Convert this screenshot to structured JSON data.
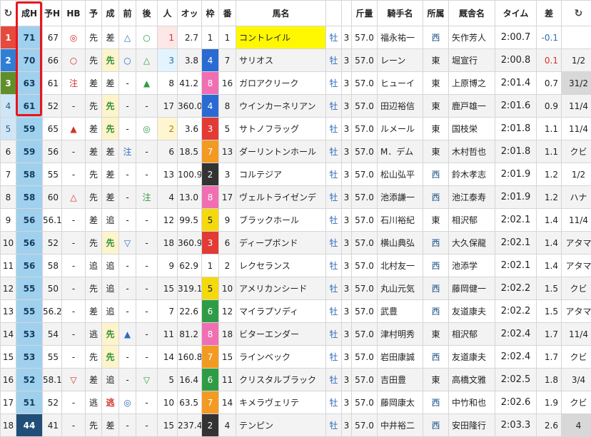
{
  "header": {
    "reload_left": "↻",
    "cols": [
      "成H",
      "予H",
      "HB",
      "予",
      "成",
      "前",
      "後",
      "人",
      "オッ",
      "枠",
      "番",
      "馬名",
      "",
      "",
      "斤量",
      "騎手名",
      "所属",
      "厩舎名",
      "タイム",
      "差"
    ],
    "reload_right": "↻"
  },
  "rows": [
    {
      "rank": "1",
      "h": "71",
      "yh": "67",
      "hb": "◎",
      "yo": "先",
      "sei": "差",
      "mae": "△",
      "ato": "○",
      "ninki": "1",
      "odds": "2.7",
      "waku": "1",
      "ban": "1",
      "name": "コントレイル",
      "sex": "牡",
      "age": "3",
      "kin": "57.0",
      "jockey": "福永祐一",
      "shozoku": "西",
      "trainer": "矢作芳人",
      "time": "2:00.7",
      "sa": "-0.1",
      "last": ""
    },
    {
      "rank": "2",
      "h": "70",
      "yh": "66",
      "hb": "○",
      "yo": "先",
      "sei": "先",
      "mae": "○",
      "ato": "△",
      "ninki": "3",
      "odds": "3.8",
      "waku": "4",
      "ban": "7",
      "name": "サリオス",
      "sex": "牡",
      "age": "3",
      "kin": "57.0",
      "jockey": "レーン",
      "shozoku": "東",
      "trainer": "堀宣行",
      "time": "2:00.8",
      "sa": "0.1",
      "last": "1/2"
    },
    {
      "rank": "3",
      "h": "63",
      "yh": "61",
      "hb": "注",
      "yo": "差",
      "sei": "差",
      "mae": "-",
      "ato": "▲",
      "ninki": "8",
      "odds": "41.2",
      "waku": "8",
      "ban": "16",
      "name": "ガロアクリーク",
      "sex": "牡",
      "age": "3",
      "kin": "57.0",
      "jockey": "ヒューイ",
      "shozoku": "東",
      "trainer": "上原博之",
      "time": "2:01.4",
      "sa": "0.7",
      "last": "31/2"
    },
    {
      "rank": "4",
      "h": "61",
      "yh": "52",
      "hb": "-",
      "yo": "先",
      "sei": "先",
      "mae": "-",
      "ato": "-",
      "ninki": "17",
      "odds": "360.0",
      "waku": "4",
      "ban": "8",
      "name": "ウインカーネリアン",
      "sex": "牡",
      "age": "3",
      "kin": "57.0",
      "jockey": "田辺裕信",
      "shozoku": "東",
      "trainer": "鹿戸雄一",
      "time": "2:01.6",
      "sa": "0.9",
      "last": "11/4"
    },
    {
      "rank": "5",
      "h": "59",
      "yh": "65",
      "hb": "▲",
      "yo": "差",
      "sei": "先",
      "mae": "-",
      "ato": "◎",
      "ninki": "2",
      "odds": "3.6",
      "waku": "3",
      "ban": "5",
      "name": "サトノフラッグ",
      "sex": "牡",
      "age": "3",
      "kin": "57.0",
      "jockey": "ルメール",
      "shozoku": "東",
      "trainer": "国枝栄",
      "time": "2:01.8",
      "sa": "1.1",
      "last": "11/4"
    },
    {
      "rank": "6",
      "h": "59",
      "yh": "56",
      "hb": "-",
      "yo": "差",
      "sei": "差",
      "mae": "注",
      "ato": "-",
      "ninki": "6",
      "odds": "18.5",
      "waku": "7",
      "ban": "13",
      "name": "ダーリントンホール",
      "sex": "牡",
      "age": "3",
      "kin": "57.0",
      "jockey": "M．デム",
      "shozoku": "東",
      "trainer": "木村哲也",
      "time": "2:01.8",
      "sa": "1.1",
      "last": "クビ"
    },
    {
      "rank": "7",
      "h": "58",
      "yh": "55",
      "hb": "-",
      "yo": "先",
      "sei": "差",
      "mae": "-",
      "ato": "-",
      "ninki": "13",
      "odds": "100.9",
      "waku": "2",
      "ban": "3",
      "name": "コルテジア",
      "sex": "牡",
      "age": "3",
      "kin": "57.0",
      "jockey": "松山弘平",
      "shozoku": "西",
      "trainer": "鈴木孝志",
      "time": "2:01.9",
      "sa": "1.2",
      "last": "1/2"
    },
    {
      "rank": "8",
      "h": "58",
      "yh": "60",
      "hb": "△",
      "yo": "先",
      "sei": "差",
      "mae": "-",
      "ato": "注",
      "ninki": "4",
      "odds": "13.0",
      "waku": "8",
      "ban": "17",
      "name": "ヴェルトライゼンデ",
      "sex": "牡",
      "age": "3",
      "kin": "57.0",
      "jockey": "池添謙一",
      "shozoku": "西",
      "trainer": "池江泰寿",
      "time": "2:01.9",
      "sa": "1.2",
      "last": "ハナ"
    },
    {
      "rank": "9",
      "h": "56",
      "yh": "56.1",
      "hb": "-",
      "yo": "差",
      "sei": "追",
      "mae": "-",
      "ato": "-",
      "ninki": "12",
      "odds": "99.5",
      "waku": "5",
      "ban": "9",
      "name": "ブラックホール",
      "sex": "牡",
      "age": "3",
      "kin": "57.0",
      "jockey": "石川裕紀",
      "shozoku": "東",
      "trainer": "相沢郁",
      "time": "2:02.1",
      "sa": "1.4",
      "last": "11/4"
    },
    {
      "rank": "10",
      "h": "56",
      "yh": "52",
      "hb": "-",
      "yo": "先",
      "sei": "先",
      "mae": "▽",
      "ato": "-",
      "ninki": "18",
      "odds": "360.9",
      "waku": "3",
      "ban": "6",
      "name": "ディープボンド",
      "sex": "牡",
      "age": "3",
      "kin": "57.0",
      "jockey": "横山典弘",
      "shozoku": "西",
      "trainer": "大久保龍",
      "time": "2:02.1",
      "sa": "1.4",
      "last": "アタマ"
    },
    {
      "rank": "11",
      "h": "56",
      "yh": "58",
      "hb": "-",
      "yo": "追",
      "sei": "追",
      "mae": "-",
      "ato": "-",
      "ninki": "9",
      "odds": "62.9",
      "waku": "1",
      "ban": "2",
      "name": "レクセランス",
      "sex": "牡",
      "age": "3",
      "kin": "57.0",
      "jockey": "北村友一",
      "shozoku": "西",
      "trainer": "池添学",
      "time": "2:02.1",
      "sa": "1.4",
      "last": "アタマ"
    },
    {
      "rank": "12",
      "h": "55",
      "yh": "50",
      "hb": "-",
      "yo": "先",
      "sei": "追",
      "mae": "-",
      "ato": "-",
      "ninki": "15",
      "odds": "319.1",
      "waku": "5",
      "ban": "10",
      "name": "アメリカンシード",
      "sex": "牡",
      "age": "3",
      "kin": "57.0",
      "jockey": "丸山元気",
      "shozoku": "西",
      "trainer": "藤岡健一",
      "time": "2:02.2",
      "sa": "1.5",
      "last": "クビ"
    },
    {
      "rank": "13",
      "h": "55",
      "yh": "56.2",
      "hb": "-",
      "yo": "差",
      "sei": "追",
      "mae": "-",
      "ato": "-",
      "ninki": "7",
      "odds": "22.6",
      "waku": "6",
      "ban": "12",
      "name": "マイラプソディ",
      "sex": "牡",
      "age": "3",
      "kin": "57.0",
      "jockey": "武豊",
      "shozoku": "西",
      "trainer": "友道康夫",
      "time": "2:02.2",
      "sa": "1.5",
      "last": "アタマ"
    },
    {
      "rank": "14",
      "h": "53",
      "yh": "54",
      "hb": "-",
      "yo": "逃",
      "sei": "先",
      "mae": "▲",
      "ato": "-",
      "ninki": "11",
      "odds": "81.2",
      "waku": "8",
      "ban": "18",
      "name": "ビターエンダー",
      "sex": "牡",
      "age": "3",
      "kin": "57.0",
      "jockey": "津村明秀",
      "shozoku": "東",
      "trainer": "相沢郁",
      "time": "2:02.4",
      "sa": "1.7",
      "last": "11/4"
    },
    {
      "rank": "15",
      "h": "53",
      "yh": "55",
      "hb": "-",
      "yo": "先",
      "sei": "先",
      "mae": "-",
      "ato": "-",
      "ninki": "14",
      "odds": "160.8",
      "waku": "7",
      "ban": "15",
      "name": "ラインベック",
      "sex": "牡",
      "age": "3",
      "kin": "57.0",
      "jockey": "岩田康誠",
      "shozoku": "西",
      "trainer": "友道康夫",
      "time": "2:02.4",
      "sa": "1.7",
      "last": "クビ"
    },
    {
      "rank": "16",
      "h": "52",
      "yh": "58.1",
      "hb": "▽",
      "yo": "差",
      "sei": "追",
      "mae": "-",
      "ato": "▽",
      "ninki": "5",
      "odds": "16.4",
      "waku": "6",
      "ban": "11",
      "name": "クリスタルブラック",
      "sex": "牡",
      "age": "3",
      "kin": "57.0",
      "jockey": "吉田豊",
      "shozoku": "東",
      "trainer": "高橋文雅",
      "time": "2:02.5",
      "sa": "1.8",
      "last": "3/4"
    },
    {
      "rank": "17",
      "h": "51",
      "yh": "52",
      "hb": "-",
      "yo": "逃",
      "sei": "逃",
      "mae": "◎",
      "ato": "-",
      "ninki": "10",
      "odds": "63.5",
      "waku": "7",
      "ban": "14",
      "name": "キメラヴェリテ",
      "sex": "牡",
      "age": "3",
      "kin": "57.0",
      "jockey": "藤岡康太",
      "shozoku": "西",
      "trainer": "中竹和也",
      "time": "2:02.6",
      "sa": "1.9",
      "last": "クビ"
    },
    {
      "rank": "18",
      "h": "44",
      "yh": "41",
      "hb": "-",
      "yo": "先",
      "sei": "差",
      "mae": "-",
      "ato": "-",
      "ninki": "15",
      "odds": "237.4",
      "waku": "2",
      "ban": "4",
      "name": "テンピン",
      "sex": "牡",
      "age": "3",
      "kin": "57.0",
      "jockey": "中井裕二",
      "shozoku": "西",
      "trainer": "安田隆行",
      "time": "2:03.3",
      "sa": "2.6",
      "last": "4"
    }
  ]
}
